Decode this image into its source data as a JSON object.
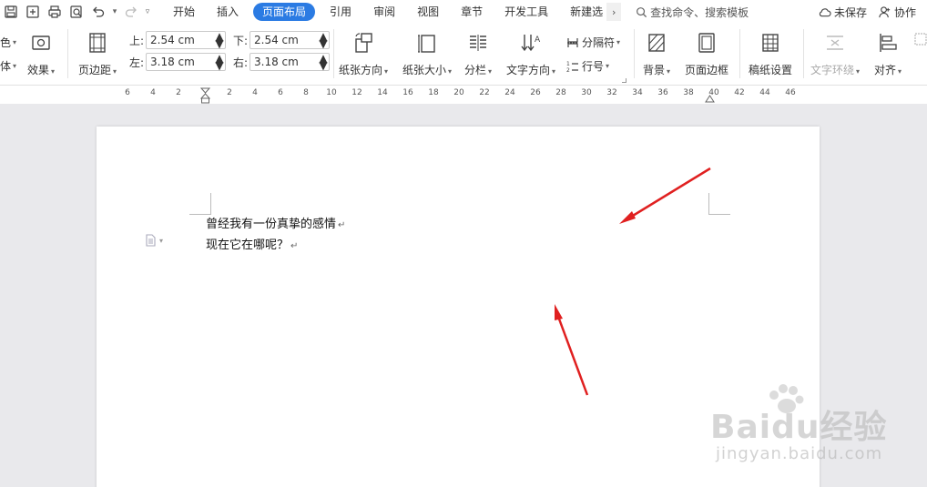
{
  "quick_access": {
    "icons": [
      "save-icon",
      "export-icon",
      "print-icon",
      "print-preview-icon",
      "undo-icon",
      "redo-icon"
    ]
  },
  "tabs": [
    {
      "label": "开始"
    },
    {
      "label": "插入"
    },
    {
      "label": "页面布局",
      "active": true
    },
    {
      "label": "引用"
    },
    {
      "label": "审阅"
    },
    {
      "label": "视图"
    },
    {
      "label": "章节"
    },
    {
      "label": "开发工具"
    },
    {
      "label": "新建选"
    }
  ],
  "search": {
    "placeholder": "查找命令、搜索模板"
  },
  "header_actions": {
    "unsaved": "未保存",
    "collab": "协作"
  },
  "ribbon": {
    "theme_color": "色",
    "theme_font": "体",
    "effects": "效果",
    "page_margin": "页边距",
    "margin_top_label": "上:",
    "margin_top_value": "2.54 cm",
    "margin_bottom_label": "下:",
    "margin_bottom_value": "2.54 cm",
    "margin_left_label": "左:",
    "margin_left_value": "3.18 cm",
    "margin_right_label": "右:",
    "margin_right_value": "3.18 cm",
    "orientation": "纸张方向",
    "paper_size": "纸张大小",
    "columns": "分栏",
    "text_direction": "文字方向",
    "separator": "分隔符",
    "line_number": "行号",
    "background": "背景",
    "page_border": "页面边框",
    "draft_setup": "稿纸设置",
    "text_wrap": "文字环绕",
    "align": "对齐"
  },
  "ruler": {
    "ticks": [
      "6",
      "4",
      "2",
      "",
      "2",
      "4",
      "6",
      "8",
      "10",
      "12",
      "14",
      "16",
      "18",
      "20",
      "22",
      "24",
      "26",
      "28",
      "30",
      "32",
      "34",
      "36",
      "38",
      "40",
      "42",
      "44",
      "46"
    ]
  },
  "document": {
    "lines": [
      "曾经我有一份真挚的感情",
      "现在它在哪呢？"
    ],
    "paragraph_mark": "↵"
  },
  "watermark": {
    "logo": "Baidu经验",
    "url": "jingyan.baidu.com"
  },
  "colors": {
    "accent": "#2b7be3",
    "arrow": "#e02020"
  }
}
